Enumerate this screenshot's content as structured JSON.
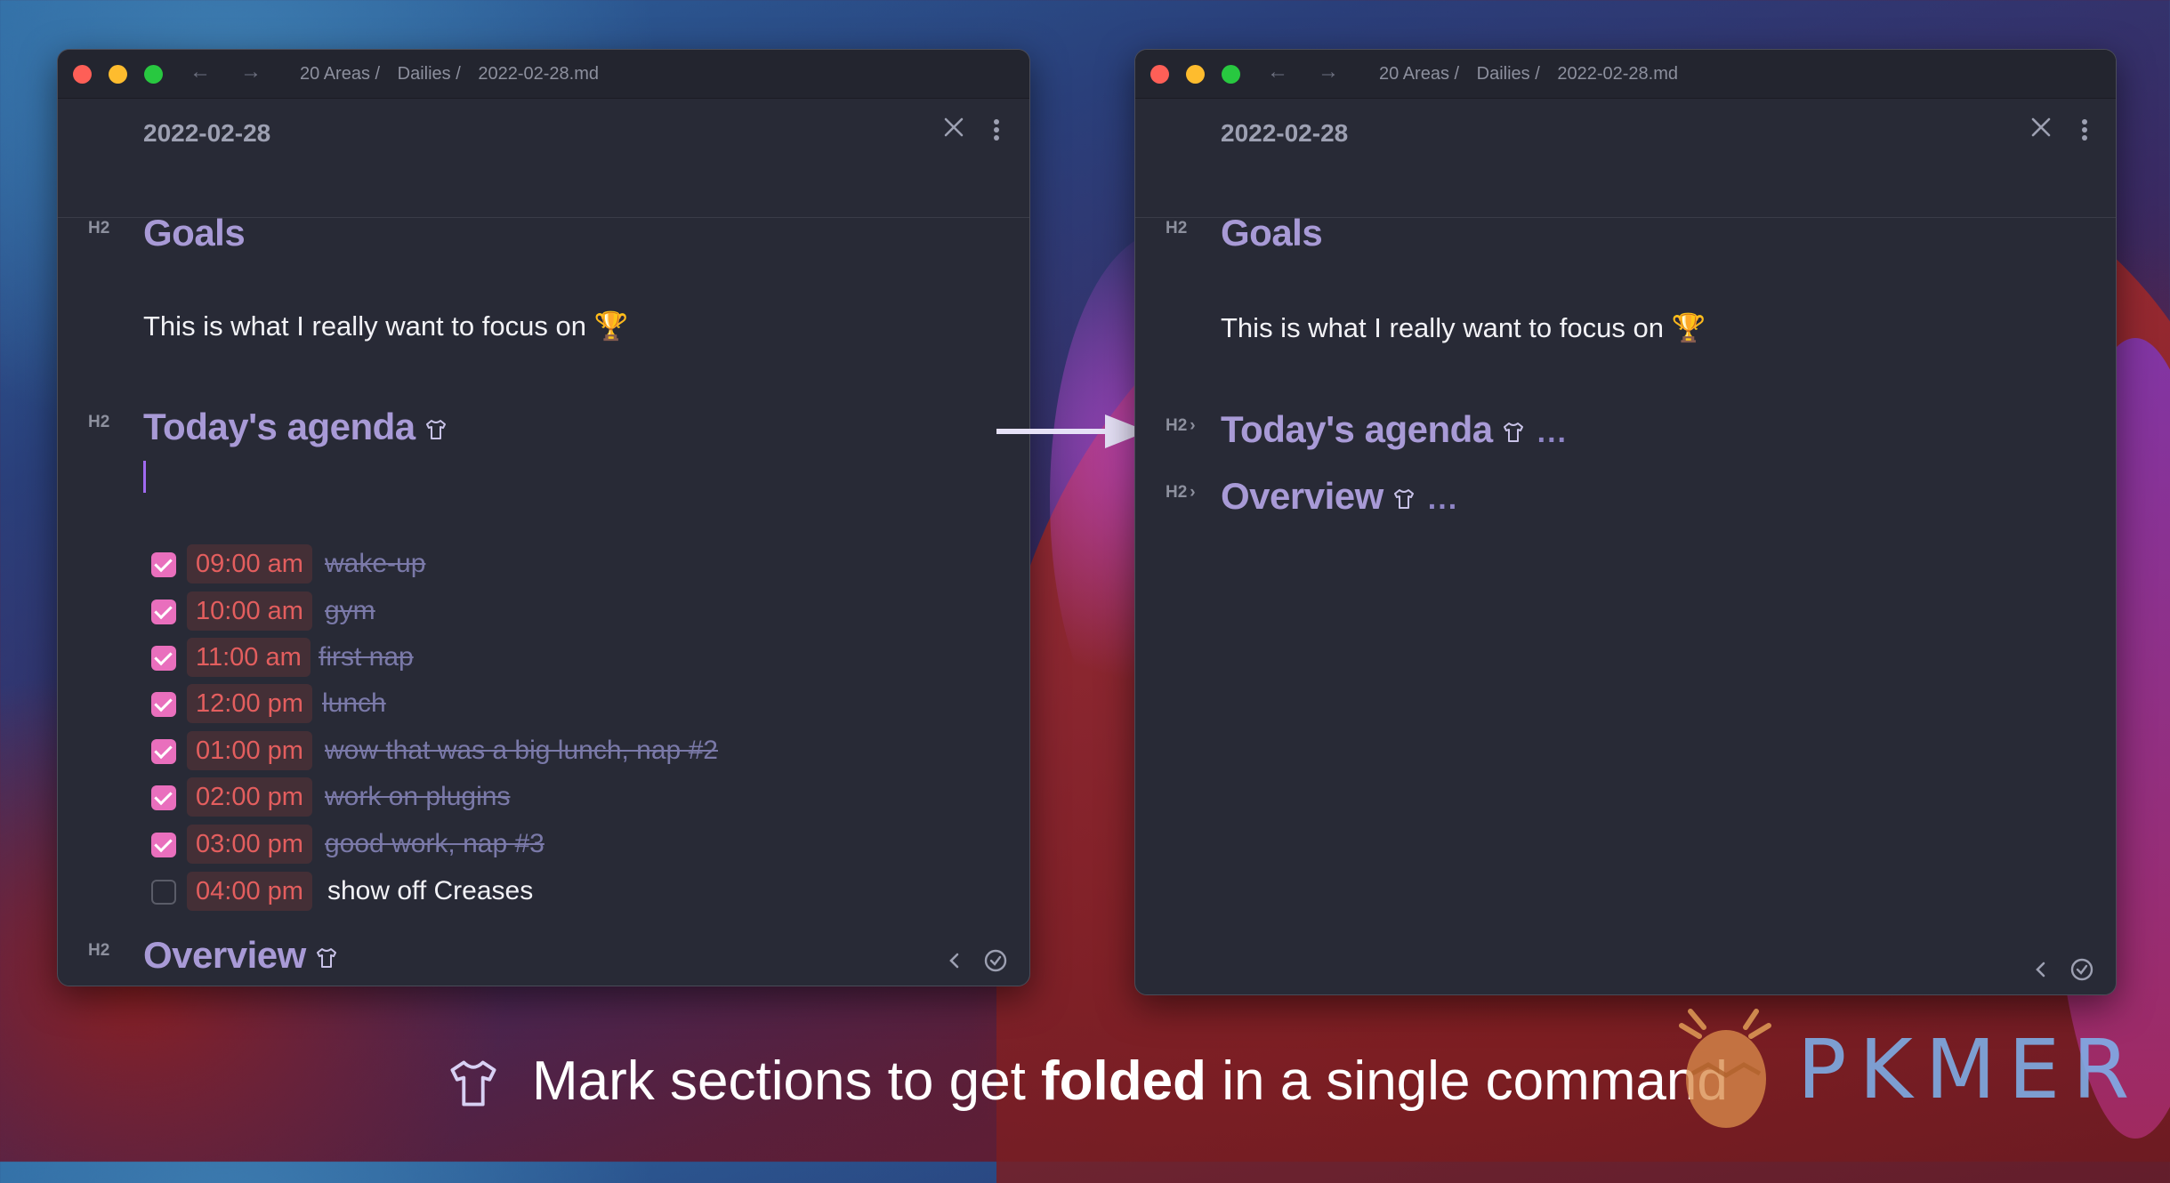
{
  "colors": {
    "accent_heading": "#a89ad6",
    "checkbox": "#e96fbd",
    "time_text": "#e35e5e",
    "done_text": "#7a79a8"
  },
  "left_window": {
    "breadcrumb": [
      "20 Areas /",
      "Dailies /",
      "2022-02-28.md"
    ],
    "view_title": "2022-02-28",
    "sections": [
      {
        "level": "H2",
        "title": "Goals"
      },
      {
        "level": "H2",
        "title": "Today's agenda"
      },
      {
        "level": "H2",
        "title": "Overview"
      }
    ],
    "goals_text": "This is what I really want to focus on 🏆",
    "tasks": [
      {
        "time": "09:00 am",
        "text": "wake-up",
        "done": true
      },
      {
        "time": "10:00 am",
        "text": "gym",
        "done": true
      },
      {
        "time": "11:00 am",
        "text": "first nap",
        "done": true
      },
      {
        "time": "12:00 pm",
        "text": "lunch",
        "done": true
      },
      {
        "time": "01:00 pm",
        "text": "wow that was a big lunch, nap #2",
        "done": true
      },
      {
        "time": "02:00 pm",
        "text": "work on plugins",
        "done": true
      },
      {
        "time": "03:00 pm",
        "text": "good work, nap #3",
        "done": true
      },
      {
        "time": "04:00 pm",
        "text": "show off Creases",
        "done": false
      }
    ]
  },
  "right_window": {
    "breadcrumb": [
      "20 Areas /",
      "Dailies /",
      "2022-02-28.md"
    ],
    "view_title": "2022-02-28",
    "sections": [
      {
        "level": "H2",
        "title": "Goals",
        "folded": false
      },
      {
        "level": "H2",
        "title": "Today's agenda",
        "folded": true
      },
      {
        "level": "H2",
        "title": "Overview",
        "folded": true
      }
    ],
    "goals_text": "This is what I really want to focus on 🏆",
    "fold_ellipsis": "..."
  },
  "icons": [
    "shirt-icon",
    "close-icon",
    "more-vertical-icon",
    "chevron-left-icon",
    "check-circle-icon",
    "arrow-right-icon"
  ],
  "caption": {
    "pre": "Mark sections to get ",
    "bold": "folded",
    "post": " in a single command"
  },
  "watermark": "PKMER"
}
